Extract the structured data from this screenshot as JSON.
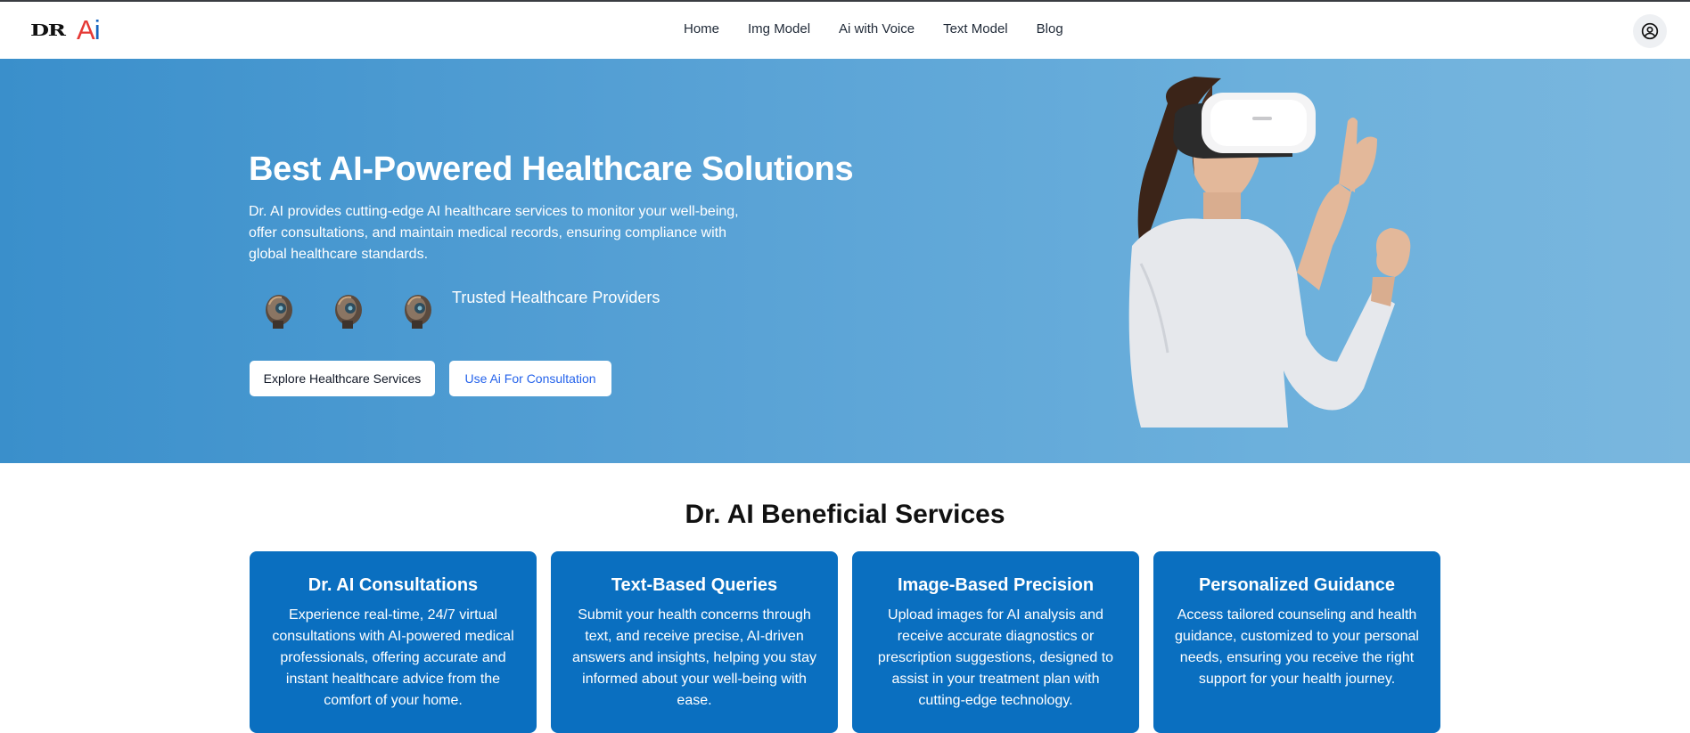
{
  "brand": {
    "logo_dr": "DR",
    "logo_a": "A",
    "logo_i": "i"
  },
  "nav": {
    "items": [
      "Home",
      "Img Model",
      "Ai with Voice",
      "Text Model",
      "Blog"
    ]
  },
  "header": {
    "user_icon": "user-circle-icon"
  },
  "hero": {
    "title": "Best AI-Powered Healthcare Solutions",
    "description": "Dr. AI provides cutting-edge AI healthcare services to monitor your well-being, offer consultations, and maintain medical records, ensuring compliance with global healthcare standards.",
    "trusted_label": "Trusted Healthcare Providers",
    "buttons": {
      "explore": "Explore Healthcare Services",
      "consult": "Use Ai For Consultation"
    }
  },
  "services": {
    "title": "Dr. AI Beneficial Services",
    "cards": [
      {
        "title": "Dr. AI Consultations",
        "text": "Experience real-time, 24/7 virtual consultations with AI-powered medical professionals, offering accurate and instant healthcare advice from the comfort of your home."
      },
      {
        "title": "Text-Based Queries",
        "text": "Submit your health concerns through text, and receive precise, AI-driven answers and insights, helping you stay informed about your well-being with ease."
      },
      {
        "title": "Image-Based Precision",
        "text": "Upload images for AI analysis and receive accurate diagnostics or prescription suggestions, designed to assist in your treatment plan with cutting-edge technology."
      },
      {
        "title": "Personalized Guidance",
        "text": "Access tailored counseling and health guidance, customized to your personal needs, ensuring you receive the right support for your health journey."
      }
    ]
  },
  "colors": {
    "hero_start": "#3a8fcb",
    "hero_end": "#7ab7de",
    "card_bg": "#0a6fc0",
    "consult_btn_text": "#2563eb",
    "logo_a": "#e53935",
    "logo_i": "#1565c0"
  }
}
